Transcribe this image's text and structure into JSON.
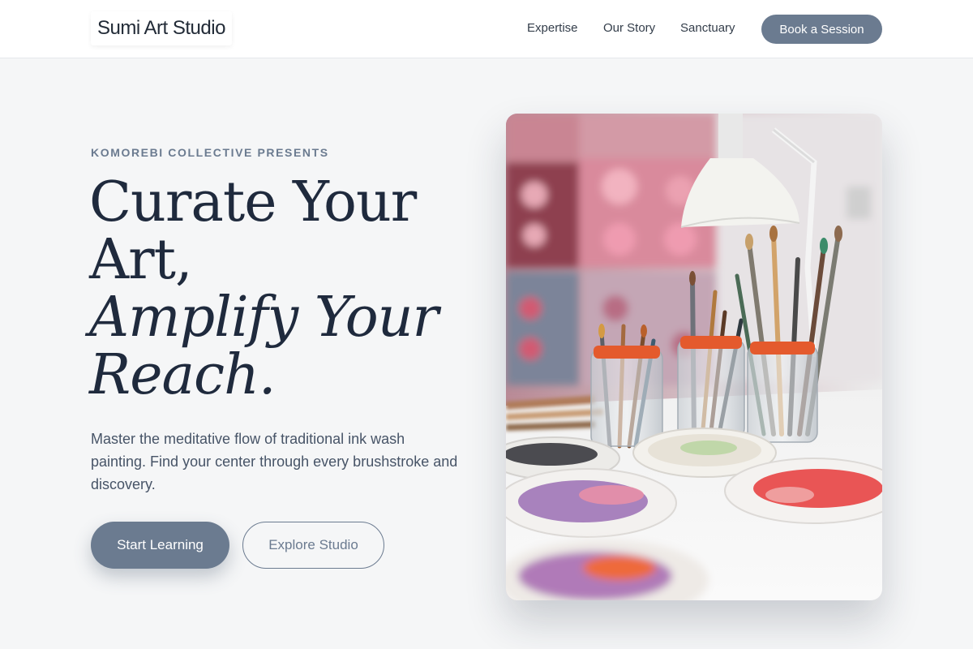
{
  "header": {
    "brand": "Sumi Art Studio",
    "nav": [
      {
        "label": "Expertise"
      },
      {
        "label": "Our Story"
      },
      {
        "label": "Sanctuary"
      }
    ],
    "cta_label": "Book a Session"
  },
  "hero": {
    "eyebrow": "KOMOREBI COLLECTIVE PRESENTS",
    "headline_line1": "Curate Your",
    "headline_line2": "Art,",
    "headline_line3": "Amplify Your",
    "headline_line4": "Reach.",
    "description": "Master the meditative flow of traditional ink wash painting. Find your center through every brushstroke and discovery.",
    "primary_button": "Start Learning",
    "secondary_button": "Explore Studio",
    "image_subject": "art-studio-brushes-and-palettes-photo"
  },
  "colors": {
    "accent": "#6b7b90",
    "heading": "#1f2a3d",
    "page_bg": "#f5f6f7",
    "header_bg": "#ffffff"
  }
}
